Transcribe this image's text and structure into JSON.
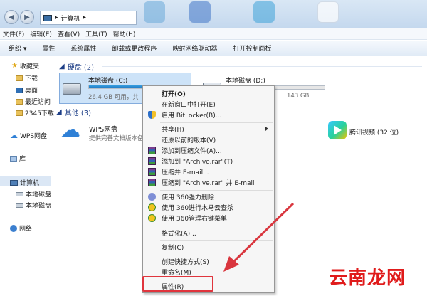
{
  "address": {
    "path": "计算机",
    "separator": "▸"
  },
  "menubar": [
    "文件(F)",
    "编辑(E)",
    "查看(V)",
    "工具(T)",
    "帮助(H)"
  ],
  "toolbar": {
    "organize": "组织 ▾",
    "items": [
      "属性",
      "系统属性",
      "卸载或更改程序",
      "映射网络驱动器",
      "打开控制面板"
    ]
  },
  "sidebar": {
    "favorites": "收藏夹",
    "downloads": "下载",
    "desktop": "桌面",
    "recent": "最近访问",
    "folder2345": "2345下载",
    "wps": "WPS网盘",
    "library": "库",
    "computer": "计算机",
    "local1": "本地磁盘",
    "local2": "本地磁盘",
    "network": "网络"
  },
  "content": {
    "hdd_group": "硬盘 (2)",
    "other_group": "其他 (3)",
    "drive_c": {
      "name": "本地磁盘 (C:)",
      "free": "26.4 GB 可用，共",
      "used_fraction": 0.78
    },
    "drive_d": {
      "name": "本地磁盘 (D:)",
      "free": "143 GB",
      "used_fraction": 0.02
    },
    "wps_title": "WPS网盘",
    "wps_subtitle": "提供完善文档版本备份",
    "tencent": "腾讯视频 (32 位)"
  },
  "context_menu": {
    "open": "打开(O)",
    "open_new_window": "在新窗口中打开(E)",
    "bitlocker": "启用 BitLocker(B)...",
    "share": "共享(H)",
    "restore": "还原以前的版本(V)",
    "add_archive": "添加到压缩文件(A)...",
    "add_rar": "添加到 \"Archive.rar\"(T)",
    "compress_email": "压缩并 E-mail...",
    "compress_rar_email": "压缩到 \"Archive.rar\" 并 E-mail",
    "del360": "使用 360强力删除",
    "scan360": "使用 360进行木马云查杀",
    "menu360": "使用 360管理右键菜单",
    "format": "格式化(A)...",
    "copy": "复制(C)",
    "shortcut": "创建快捷方式(S)",
    "rename": "重命名(M)",
    "properties": "属性(R)"
  },
  "watermark": "云南龙网",
  "colors": {
    "accent": "#1e3f87",
    "highlight": "#e0353d",
    "arrow": "#d9363e"
  }
}
